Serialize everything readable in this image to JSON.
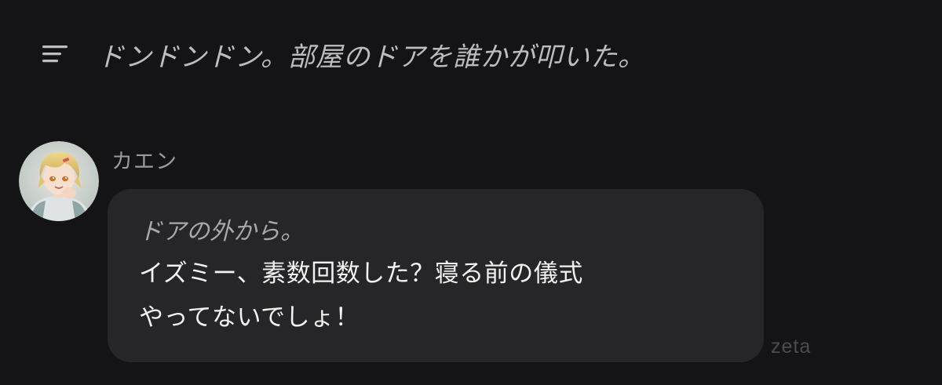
{
  "header": {
    "menu_icon": "menu-lines-icon",
    "narration": "ドンドンドン。部屋のドアを誰かが叩いた。"
  },
  "message": {
    "avatar_icon": "character-avatar",
    "character_name": "カエン",
    "narration": "ドアの外から。",
    "lines": [
      "イズミー、素数回数した？寝る前の儀式",
      "やってないでしょ！"
    ]
  },
  "watermark": "zeta",
  "colors": {
    "background": "#141416",
    "bubble": "#262628",
    "narration_text": "#bdbdbf",
    "message_text": "#f2f2f2"
  }
}
